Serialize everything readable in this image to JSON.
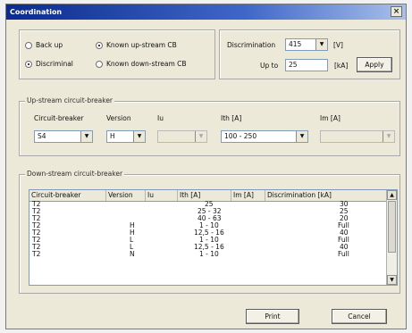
{
  "window": {
    "title": "Coordination",
    "close_glyph": "×"
  },
  "mode": {
    "backup_label": "Back up",
    "discriminal_label": "Discriminal",
    "selected": "discriminal"
  },
  "known": {
    "upstream_label": "Known up-stream CB",
    "downstream_label": "Known down-stream CB",
    "selected": "upstream"
  },
  "discrimination": {
    "label": "Discrimination",
    "value": "415",
    "unit": "[V]",
    "upto_label": "Up to",
    "upto_value": "25",
    "upto_unit": "[kA]",
    "apply_label": "Apply"
  },
  "upstream": {
    "legend": "Up-stream circuit-breaker",
    "headers": {
      "cb": "Circuit-breaker",
      "version": "Version",
      "iu": "Iu",
      "ith": "Ith [A]",
      "im": "Im [A]"
    },
    "values": {
      "cb": "S4",
      "version": "H",
      "iu": "",
      "ith": "100 - 250",
      "im": ""
    }
  },
  "downstream": {
    "legend": "Down-stream circuit-breaker",
    "columns": [
      "Circuit-breaker",
      "Version",
      "Iu",
      "Ith [A]",
      "Im [A]",
      "Discrimination [kA]"
    ],
    "rows": [
      {
        "cb": "T2",
        "version": "",
        "iu": "",
        "ith": "25",
        "im": "",
        "disc": "30"
      },
      {
        "cb": "T2",
        "version": "",
        "iu": "",
        "ith": "25 - 32",
        "im": "",
        "disc": "25"
      },
      {
        "cb": "T2",
        "version": "",
        "iu": "",
        "ith": "40 - 63",
        "im": "",
        "disc": "20"
      },
      {
        "cb": "T2",
        "version": "H",
        "iu": "",
        "ith": "1 - 10",
        "im": "",
        "disc": "Full"
      },
      {
        "cb": "T2",
        "version": "H",
        "iu": "",
        "ith": "12,5 - 16",
        "im": "",
        "disc": "40"
      },
      {
        "cb": "T2",
        "version": "L",
        "iu": "",
        "ith": "1 - 10",
        "im": "",
        "disc": "Full"
      },
      {
        "cb": "T2",
        "version": "L",
        "iu": "",
        "ith": "12,5 - 16",
        "im": "",
        "disc": "40"
      },
      {
        "cb": "T2",
        "version": "N",
        "iu": "",
        "ith": "1 - 10",
        "im": "",
        "disc": "Full"
      }
    ]
  },
  "buttons": {
    "print": "Print",
    "cancel": "Cancel"
  },
  "icons": {
    "dropdown": "▼",
    "scroll_up": "▲",
    "scroll_down": "▼"
  }
}
